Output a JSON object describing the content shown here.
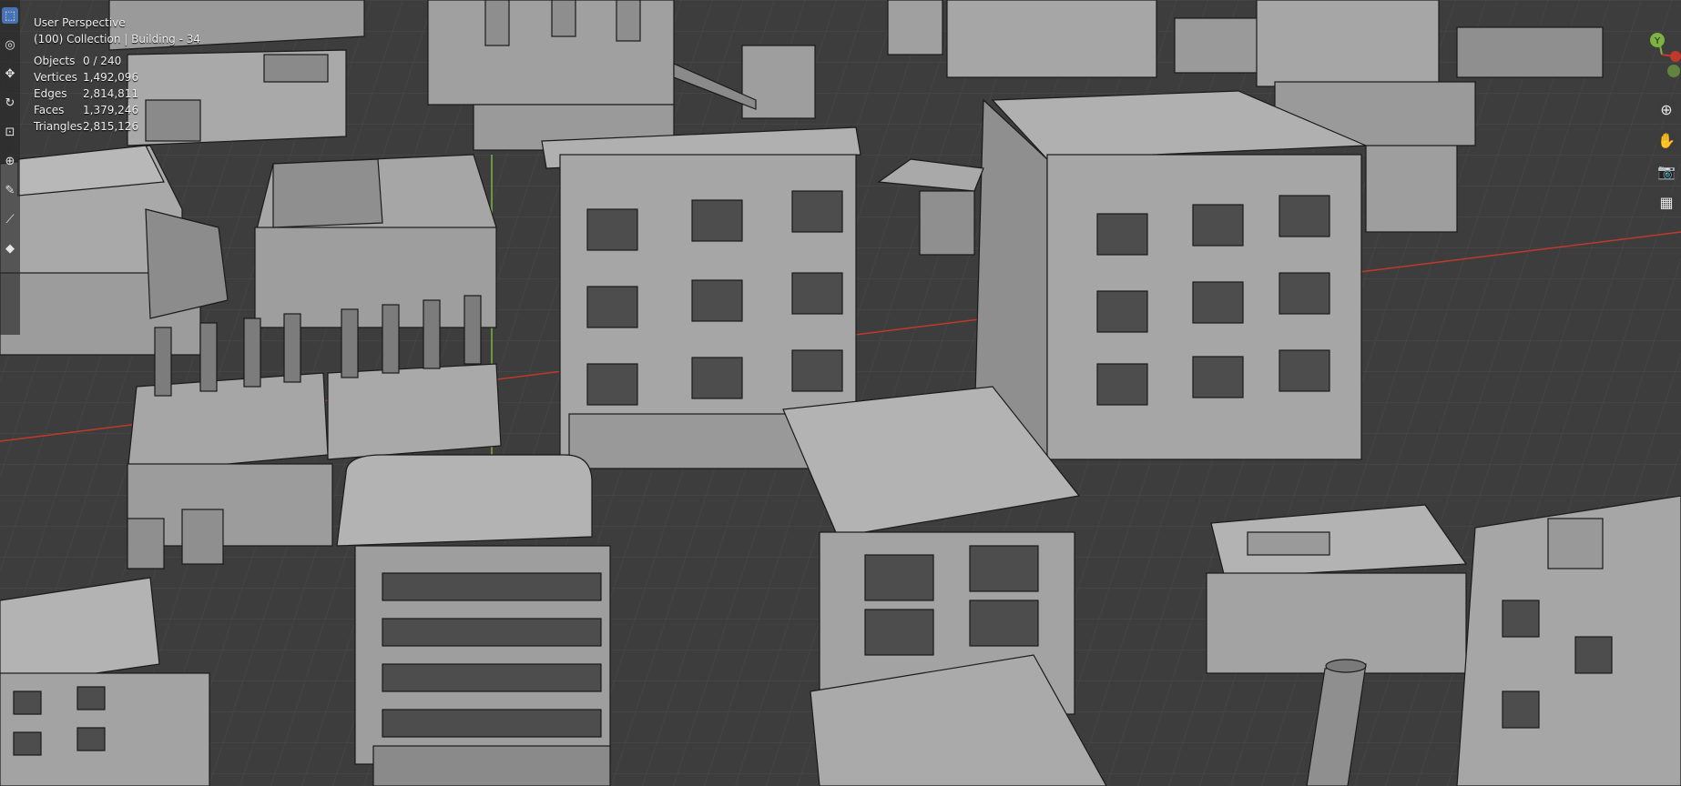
{
  "viewport": {
    "view_name": "User Perspective",
    "collection": "(100) Collection | Building - 34"
  },
  "stats": [
    {
      "label": "Objects",
      "value": "0 / 240"
    },
    {
      "label": "Vertices",
      "value": "1,492,096"
    },
    {
      "label": "Edges",
      "value": "2,814,811"
    },
    {
      "label": "Faces",
      "value": "1,379,246"
    },
    {
      "label": "Triangles",
      "value": "2,815,126"
    }
  ],
  "tools": [
    {
      "icon": "select-box-icon",
      "glyph": "⬚",
      "active": true
    },
    {
      "icon": "cursor-icon",
      "glyph": "◎",
      "active": false
    },
    {
      "icon": "move-icon",
      "glyph": "✥",
      "active": false
    },
    {
      "icon": "rotate-icon",
      "glyph": "↻",
      "active": false
    },
    {
      "icon": "scale-icon",
      "glyph": "⊡",
      "active": false
    },
    {
      "icon": "transform-icon",
      "glyph": "⊕",
      "active": false
    },
    {
      "icon": "annotate-icon",
      "glyph": "✎",
      "active": false
    },
    {
      "icon": "measure-icon",
      "glyph": "⟋",
      "active": false
    },
    {
      "icon": "add-cube-icon",
      "glyph": "◆",
      "active": false
    }
  ],
  "navigation": [
    {
      "icon": "zoom-icon",
      "glyph": "⊕"
    },
    {
      "icon": "pan-hand-icon",
      "glyph": "✋"
    },
    {
      "icon": "camera-icon",
      "glyph": "📷"
    },
    {
      "icon": "ortho-grid-icon",
      "glyph": "▦"
    }
  ],
  "gizmo_axis_label": "Y",
  "colors": {
    "accent": "#4772b3",
    "grid_bg": "#3d3d3d",
    "grid_line": "#4a4a4a",
    "x_axis": "#c0392b",
    "y_axis": "#7cb342",
    "building": "#a9a9a9",
    "building_shade": "#8a8a8a",
    "building_dark": "#6e6e6e",
    "edge": "#1a1a1a",
    "window": "#4d4d4d"
  }
}
